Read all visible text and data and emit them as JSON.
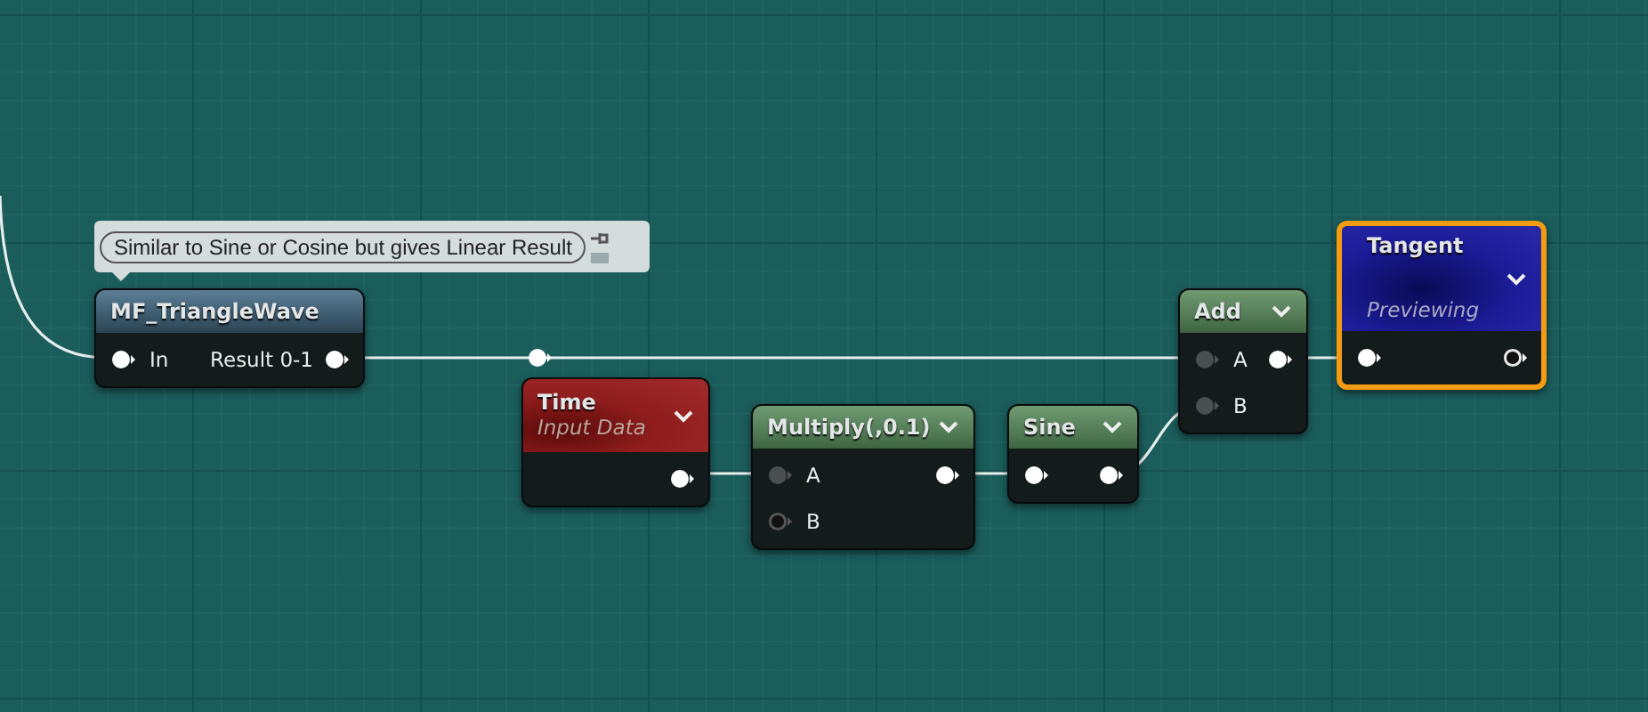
{
  "comment": {
    "text": "Similar to Sine or Cosine but gives Linear Result"
  },
  "nodes": [
    {
      "kind": "function",
      "title": "MF_TriangleWave",
      "selected": false,
      "inputs": [
        {
          "label": "In",
          "kind": "filled"
        }
      ],
      "outputs": [
        {
          "label": "Result 0-1",
          "kind": "filled"
        }
      ]
    },
    {
      "kind": "input",
      "title": "Time",
      "subtitle": "Input Data",
      "selected": false,
      "outputs": [
        {
          "kind": "filled"
        }
      ]
    },
    {
      "kind": "math",
      "title": "Multiply(,0.1)",
      "selected": false,
      "inputs": [
        {
          "label": "A",
          "kind": "dim"
        },
        {
          "label": "B",
          "kind": "hollow"
        }
      ],
      "outputs": [
        {
          "kind": "filled"
        }
      ]
    },
    {
      "kind": "math",
      "title": "Sine",
      "selected": false,
      "inputs": [
        {
          "kind": "filled"
        }
      ],
      "outputs": [
        {
          "kind": "filled"
        }
      ]
    },
    {
      "kind": "math",
      "title": "Add",
      "selected": false,
      "inputs": [
        {
          "label": "A",
          "kind": "dim"
        },
        {
          "label": "B",
          "kind": "dim"
        }
      ],
      "outputs": [
        {
          "kind": "filled"
        }
      ]
    },
    {
      "kind": "preview",
      "title": "Tangent",
      "subtitle": "Previewing",
      "selected": true,
      "inputs": [
        {
          "kind": "filled"
        }
      ],
      "outputs": [
        {
          "kind": "hollow"
        }
      ]
    }
  ]
}
